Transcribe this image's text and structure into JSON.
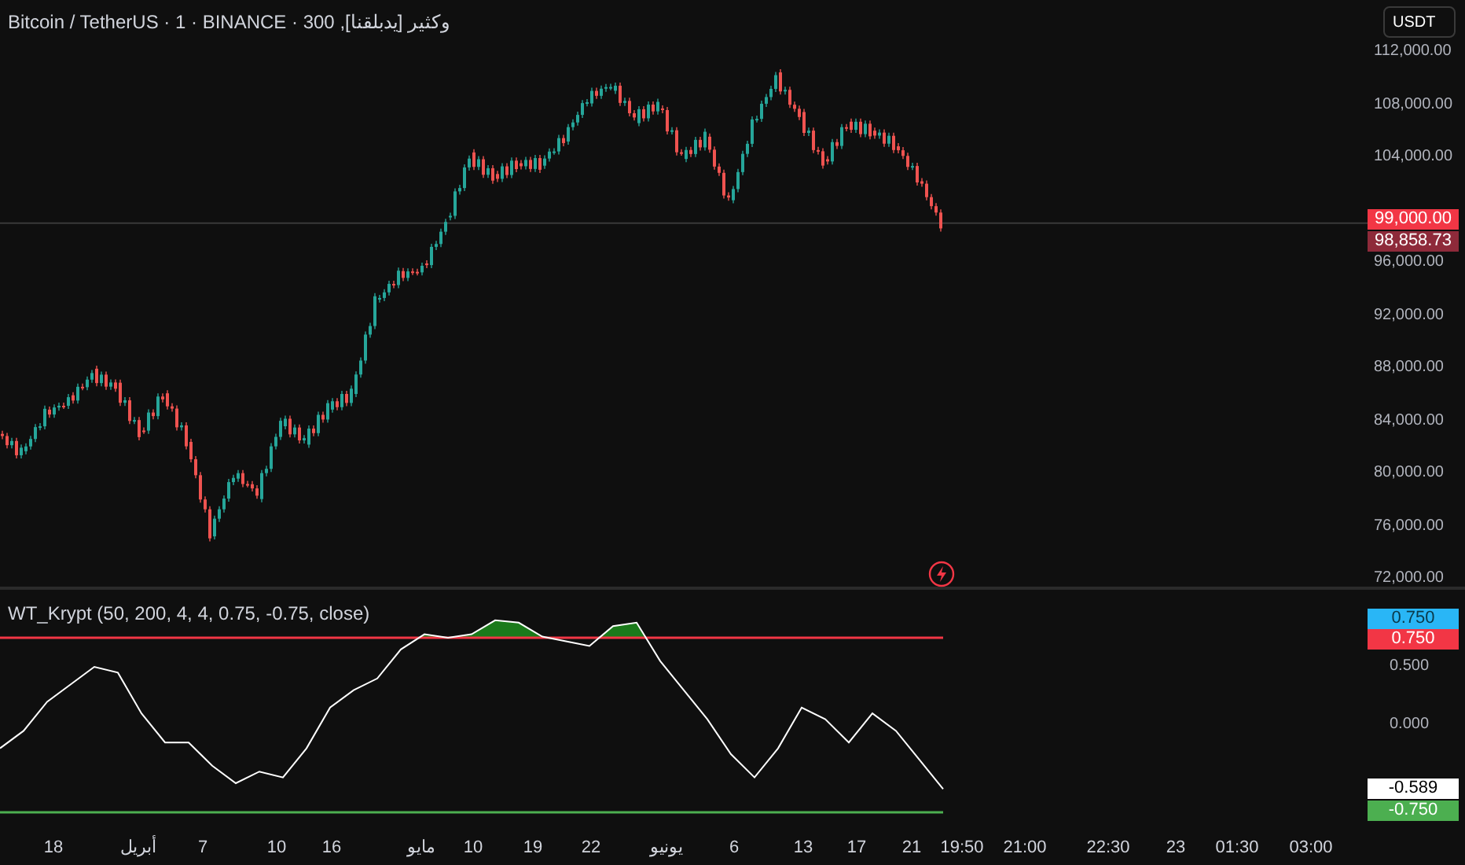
{
  "header": {
    "title": "Bitcoin / TetherUS · 1 · BINANCE · 300 ,وكثير [يدبلقنا]",
    "currency_button": "USDT"
  },
  "price_axis": [
    "112,000.00",
    "108,000.00",
    "104,000.00",
    "96,000.00",
    "92,000.00",
    "88,000.00",
    "84,000.00",
    "80,000.00",
    "76,000.00",
    "72,000.00"
  ],
  "price_tags": [
    {
      "label": "99,000.00",
      "color": "#f23645"
    },
    {
      "label": "98,858.73",
      "color": "#8e2a3a"
    }
  ],
  "indicator": {
    "label": "WT_Krypt (50, 200, 4, 4, 0.75, -0.75, close)",
    "axis": [
      "0.500",
      "0.000"
    ],
    "value_tags": [
      {
        "label": "0.750",
        "color": "#29b6f6"
      },
      {
        "label": "0.750",
        "color": "#f23645"
      },
      {
        "label": "-0.589",
        "color": "#ffffff"
      },
      {
        "label": "-0.750",
        "color": "#4caf50"
      }
    ]
  },
  "time_axis": [
    "18",
    "أبريل",
    "7",
    "10",
    "16",
    "مايو",
    "10",
    "19",
    "22",
    "يونيو",
    "6",
    "13",
    "17",
    "21",
    "19:50",
    "21:00",
    "22:30",
    "23",
    "01:30",
    "03:00"
  ]
}
